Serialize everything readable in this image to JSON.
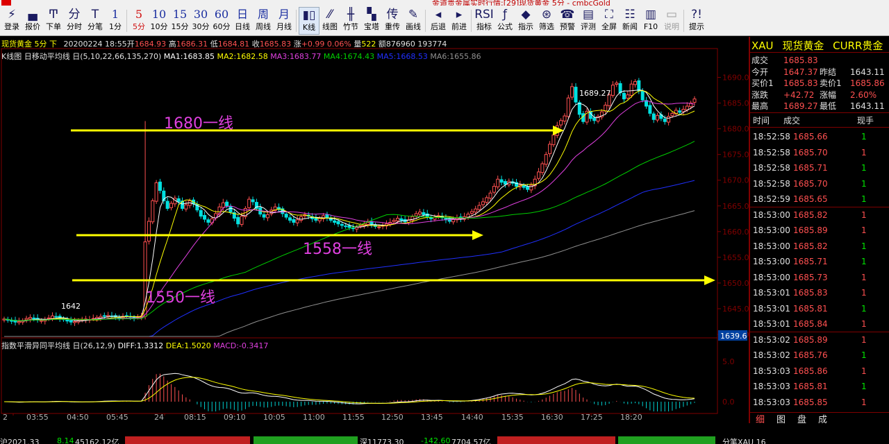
{
  "window": {
    "title_fragment": "金道贵金属实时行情:[29]现货黄金 5分 - cmbcGold",
    "colors": {
      "background": "#000000",
      "up": "#ff5050",
      "down": "#00e600",
      "accent_yellow": "#ffff00",
      "magenta": "#e040e0"
    }
  },
  "toolbar": {
    "items": [
      {
        "icon": "⚡",
        "label": "登录"
      },
      {
        "icon": "▄",
        "label": "报价"
      },
      {
        "icon": "Ͳ",
        "label": "下单"
      },
      {
        "icon": "分",
        "label": "分时"
      },
      {
        "icon": "T",
        "label": "分笔"
      },
      {
        "icon": "1",
        "label": "1分"
      },
      {
        "icon": "5",
        "label": "5分"
      },
      {
        "icon": "10",
        "label": "10分"
      },
      {
        "icon": "15",
        "label": "15分"
      },
      {
        "icon": "30",
        "label": "30分"
      },
      {
        "icon": "60",
        "label": "60分"
      },
      {
        "icon": "日",
        "label": "日线"
      },
      {
        "icon": "周",
        "label": "周线"
      },
      {
        "icon": "月",
        "label": "月线"
      },
      {
        "icon": "▮▯",
        "label": "K线"
      },
      {
        "icon": "⁄⁄",
        "label": "线图"
      },
      {
        "icon": "╫",
        "label": "竹节"
      },
      {
        "icon": "▚",
        "label": "宝塔"
      },
      {
        "icon": "传",
        "label": "重传"
      },
      {
        "icon": "✎",
        "label": "画线"
      },
      {
        "icon": "◂",
        "label": "后退"
      },
      {
        "icon": "▸",
        "label": "前进"
      },
      {
        "icon": "RSI",
        "label": "指标"
      },
      {
        "icon": "ƒ",
        "label": "公式"
      },
      {
        "icon": "◆",
        "label": "指示"
      },
      {
        "icon": "⊛",
        "label": "筛选"
      },
      {
        "icon": "☎",
        "label": "预警"
      },
      {
        "icon": "▤",
        "label": "评测"
      },
      {
        "icon": "⛶",
        "label": "全屏"
      },
      {
        "icon": "☷",
        "label": "新闻"
      },
      {
        "icon": "▥",
        "label": "F10"
      },
      {
        "icon": "▭",
        "label": "说明"
      },
      {
        "icon": "?!",
        "label": "提示"
      }
    ]
  },
  "chart_header": {
    "symbol_name": "现货黄金",
    "period": "5分",
    "dir": "下",
    "datetime": "20200224 18:55",
    "open_label": "开",
    "open": "1684.93",
    "high_label": "高",
    "high": "1686.31",
    "low_label": "低",
    "low": "1684.81",
    "close_label": "收",
    "close": "1685.83",
    "change_label": "涨",
    "change": "+0.99 0.06%",
    "volume_label": "量",
    "volume": "522",
    "amount_label": "额",
    "amount": "876960 193774"
  },
  "ma_legend": {
    "name": "K线图",
    "indicator": "日移动平均线",
    "params": "日(5,10,22,66,135,270)",
    "ma1": "MA1:1683.85",
    "ma2": "MA2:1682.58",
    "ma3": "MA3:1683.77",
    "ma4": "MA4:1674.43",
    "ma5": "MA5:1668.53",
    "ma6": "MA6:1655.86"
  },
  "macd_legend": {
    "indicator": "指数平滑异同平均线",
    "params": "日(26,12,9)",
    "diff": "DIFF:1.3312",
    "dea": "DEA:1.5020",
    "macd": "MACD:-0.3417"
  },
  "annotations": {
    "line_1680": "1680一线",
    "line_1558": "1558一线",
    "line_1550": "1550一线",
    "high_marker": "1689.27",
    "low_marker": "1642"
  },
  "chart_data": {
    "type": "candlestick",
    "symbol": "XAU",
    "period": "5分",
    "y_axis_labels": [
      "1690.0",
      "1685.0",
      "1680.0",
      "1675.0",
      "1670.0",
      "1665.0",
      "1660.0",
      "1655.0",
      "1650.0",
      "1645.0",
      "1640.0"
    ],
    "ylim": [
      1639.6,
      1692.5
    ],
    "current_price_tag": "1639.6",
    "x_axis_labels": [
      "2",
      "03:55",
      "04:50",
      "05:45",
      "24",
      "08:15",
      "09:10",
      "10:05",
      "11:00",
      "11:55",
      "12:50",
      "13:45",
      "14:40",
      "15:35",
      "16:30",
      "17:25",
      "18:20"
    ],
    "close_series": [
      1643.0,
      1642.8,
      1642.6,
      1642.4,
      1642.5,
      1642.7,
      1643.1,
      1643.3,
      1643.0,
      1642.8,
      1642.7,
      1642.9,
      1643.2,
      1643.6,
      1643.4,
      1643.1,
      1642.9,
      1642.6,
      1642.4,
      1642.5,
      1642.7,
      1642.9,
      1643.0,
      1642.9,
      1643.1,
      1643.3,
      1643.5,
      1643.6,
      1643.7,
      1643.5,
      1643.4,
      1643.3,
      1643.5,
      1643.6,
      1643.4,
      1643.2,
      1643.4,
      1643.6,
      1658.0,
      1662.0,
      1666.0,
      1669.5,
      1668.0,
      1666.0,
      1664.5,
      1665.5,
      1666.5,
      1665.8,
      1664.5,
      1665.2,
      1666.0,
      1665.4,
      1664.2,
      1663.0,
      1662.4,
      1661.8,
      1662.5,
      1663.5,
      1664.8,
      1665.6,
      1665.0,
      1663.8,
      1662.6,
      1661.5,
      1663.0,
      1664.5,
      1666.3,
      1665.8,
      1664.5,
      1663.4,
      1662.8,
      1663.3,
      1664.2,
      1664.8,
      1664.3,
      1663.5,
      1662.8,
      1662.2,
      1661.8,
      1662.3,
      1662.9,
      1663.3,
      1663.0,
      1662.5,
      1662.2,
      1662.6,
      1663.1,
      1662.7,
      1662.2,
      1661.8,
      1661.5,
      1661.2,
      1661.0,
      1660.8,
      1660.6,
      1660.9,
      1661.2,
      1661.5,
      1661.8,
      1661.4,
      1661.0,
      1660.9,
      1661.2,
      1661.5,
      1661.8,
      1662.2,
      1662.6,
      1662.2,
      1661.9,
      1662.3,
      1662.9,
      1663.5,
      1663.8,
      1663.3,
      1662.9,
      1662.5,
      1662.8,
      1663.1,
      1662.7,
      1662.3,
      1662.0,
      1662.4,
      1662.7,
      1662.5,
      1662.9,
      1663.4,
      1663.9,
      1664.4,
      1665.1,
      1665.8,
      1666.6,
      1667.5,
      1668.8,
      1670.2,
      1669.6,
      1669.2,
      1669.8,
      1669.4,
      1668.8,
      1669.1,
      1668.6,
      1668.2,
      1669.0,
      1670.2,
      1671.6,
      1673.2,
      1675.0,
      1677.0,
      1678.8,
      1680.6,
      1681.6,
      1682.5,
      1686.0,
      1688.2,
      1685.2,
      1682.8,
      1681.4,
      1683.4,
      1682.0,
      1681.6,
      1682.4,
      1683.3,
      1684.6,
      1686.6,
      1688.5,
      1688.9,
      1687.0,
      1685.8,
      1686.6,
      1688.7,
      1689.2,
      1687.4,
      1685.6,
      1684.4,
      1683.0,
      1681.8,
      1682.6,
      1682.0,
      1681.4,
      1682.4,
      1683.0,
      1683.6,
      1683.2,
      1683.8,
      1684.4,
      1685.0,
      1685.8
    ],
    "ma_series": [
      {
        "name": "MA1",
        "color": "#ffffff",
        "value": 1683.85
      },
      {
        "name": "MA2",
        "color": "#ffff00",
        "value": 1682.58
      },
      {
        "name": "MA3",
        "color": "#e040e0",
        "value": 1683.77
      },
      {
        "name": "MA4",
        "color": "#00d000",
        "value": 1674.43
      },
      {
        "name": "MA5",
        "color": "#2030ff",
        "value": 1668.53
      },
      {
        "name": "MA6",
        "color": "#909090",
        "value": 1655.86
      }
    ],
    "macd": {
      "y_axis_labels": [
        "5.0",
        "0.0"
      ],
      "diff": 1.3312,
      "dea": 1.502,
      "macd": -0.3417
    }
  },
  "quote_panel": {
    "code": "XAU",
    "name": "现货黄金",
    "category": "CURR贵金",
    "rows": [
      {
        "l1": "成交",
        "v1": "1685.83",
        "c1": "up",
        "l2": "",
        "v2": "",
        "c2": ""
      },
      {
        "l1": "今开",
        "v1": "1647.37",
        "c1": "up",
        "l2": "昨结",
        "v2": "1643.11",
        "c2": "wh"
      },
      {
        "l1": "买价1",
        "v1": "1685.83",
        "c1": "up",
        "l2": "卖价1",
        "v2": "1685.86",
        "c2": "up"
      },
      {
        "l1": "涨跌",
        "v1": "+42.72",
        "c1": "up",
        "l2": "涨幅",
        "v2": "2.60%",
        "c2": "up"
      },
      {
        "l1": "最高",
        "v1": "1689.27",
        "c1": "up",
        "l2": "最低",
        "v2": "1643.11",
        "c2": "wh"
      }
    ],
    "ticks_header": {
      "time": "时间",
      "price": "成交",
      "volume": "现手"
    },
    "ticks": [
      {
        "time": "18:52:58",
        "price": "1685.66",
        "vol": "1",
        "c": "dn"
      },
      {
        "time": "18:52:58",
        "price": "1685.70",
        "vol": "1",
        "c": "up"
      },
      {
        "time": "18:52:58",
        "price": "1685.71",
        "vol": "1",
        "c": "dn"
      },
      {
        "time": "18:52:58",
        "price": "1685.70",
        "vol": "1",
        "c": "dn"
      },
      {
        "time": "18:52:59",
        "price": "1685.65",
        "vol": "1",
        "c": "dn"
      },
      {
        "time": "18:53:00",
        "price": "1685.82",
        "vol": "1",
        "c": "up"
      },
      {
        "time": "18:53:00",
        "price": "1685.89",
        "vol": "1",
        "c": "up"
      },
      {
        "time": "18:53:00",
        "price": "1685.82",
        "vol": "1",
        "c": "dn"
      },
      {
        "time": "18:53:00",
        "price": "1685.71",
        "vol": "1",
        "c": "dn"
      },
      {
        "time": "18:53:00",
        "price": "1685.73",
        "vol": "1",
        "c": "up"
      },
      {
        "time": "18:53:01",
        "price": "1685.83",
        "vol": "1",
        "c": "up"
      },
      {
        "time": "18:53:01",
        "price": "1685.81",
        "vol": "1",
        "c": "dn"
      },
      {
        "time": "18:53:01",
        "price": "1685.84",
        "vol": "1",
        "c": "up"
      },
      {
        "time": "18:53:02",
        "price": "1685.89",
        "vol": "1",
        "c": "up"
      },
      {
        "time": "18:53:02",
        "price": "1685.76",
        "vol": "1",
        "c": "dn"
      },
      {
        "time": "18:53:03",
        "price": "1685.86",
        "vol": "1",
        "c": "up"
      },
      {
        "time": "18:53:03",
        "price": "1685.81",
        "vol": "1",
        "c": "dn"
      },
      {
        "time": "18:53:03",
        "price": "1685.85",
        "vol": "1",
        "c": "up"
      },
      {
        "time": "18:53:03",
        "price": "1685.83",
        "vol": "1",
        "c": "dn"
      }
    ],
    "tabs": [
      "细",
      "图",
      "盘",
      "成"
    ]
  },
  "statusbar": {
    "s1": "沪2021.33",
    "s2": "8.14",
    "s3": "45162.12亿",
    "s4": "深11773.30",
    "s5": "-142.60",
    "s6": "7704.57亿",
    "s7": "分笔XAU 16"
  }
}
